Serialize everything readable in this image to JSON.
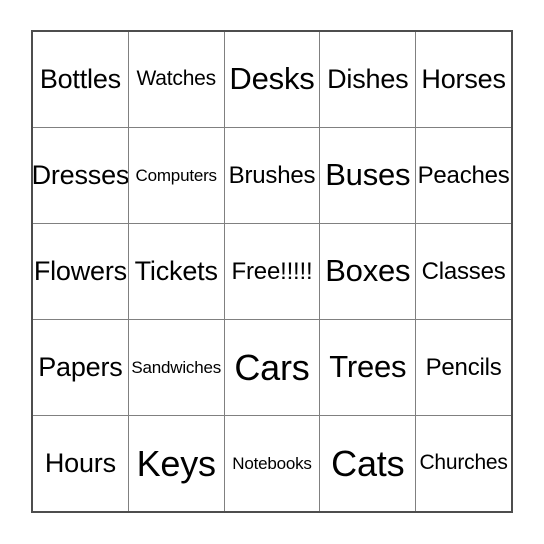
{
  "card": {
    "type": "bingo-card",
    "grid_size": "5x5",
    "free_space_position": "center",
    "colors": {
      "background": "#ffffff",
      "text": "#000000",
      "grid_line": "#808080",
      "outer_border": "#4d4d4d"
    },
    "rows": [
      {
        "cells": [
          {
            "label": "Bottles",
            "size": "l"
          },
          {
            "label": "Watches",
            "size": "s"
          },
          {
            "label": "Desks",
            "size": "xl"
          },
          {
            "label": "Dishes",
            "size": "l"
          },
          {
            "label": "Horses",
            "size": "l"
          }
        ]
      },
      {
        "cells": [
          {
            "label": "Dresses",
            "size": "l"
          },
          {
            "label": "Computers",
            "size": "xs"
          },
          {
            "label": "Brushes",
            "size": "m"
          },
          {
            "label": "Buses",
            "size": "xl"
          },
          {
            "label": "Peaches",
            "size": "m"
          }
        ]
      },
      {
        "cells": [
          {
            "label": "Flowers",
            "size": "l"
          },
          {
            "label": "Tickets",
            "size": "l"
          },
          {
            "label": "Free!!!!!",
            "size": "m"
          },
          {
            "label": "Boxes",
            "size": "xl"
          },
          {
            "label": "Classes",
            "size": "m"
          }
        ]
      },
      {
        "cells": [
          {
            "label": "Papers",
            "size": "l"
          },
          {
            "label": "Sandwiches",
            "size": "xs"
          },
          {
            "label": "Cars",
            "size": "xxl"
          },
          {
            "label": "Trees",
            "size": "xl"
          },
          {
            "label": "Pencils",
            "size": "m"
          }
        ]
      },
      {
        "cells": [
          {
            "label": "Hours",
            "size": "l"
          },
          {
            "label": "Keys",
            "size": "xxl"
          },
          {
            "label": "Notebooks",
            "size": "xs"
          },
          {
            "label": "Cats",
            "size": "xxl"
          },
          {
            "label": "Churches",
            "size": "s"
          }
        ]
      }
    ]
  }
}
